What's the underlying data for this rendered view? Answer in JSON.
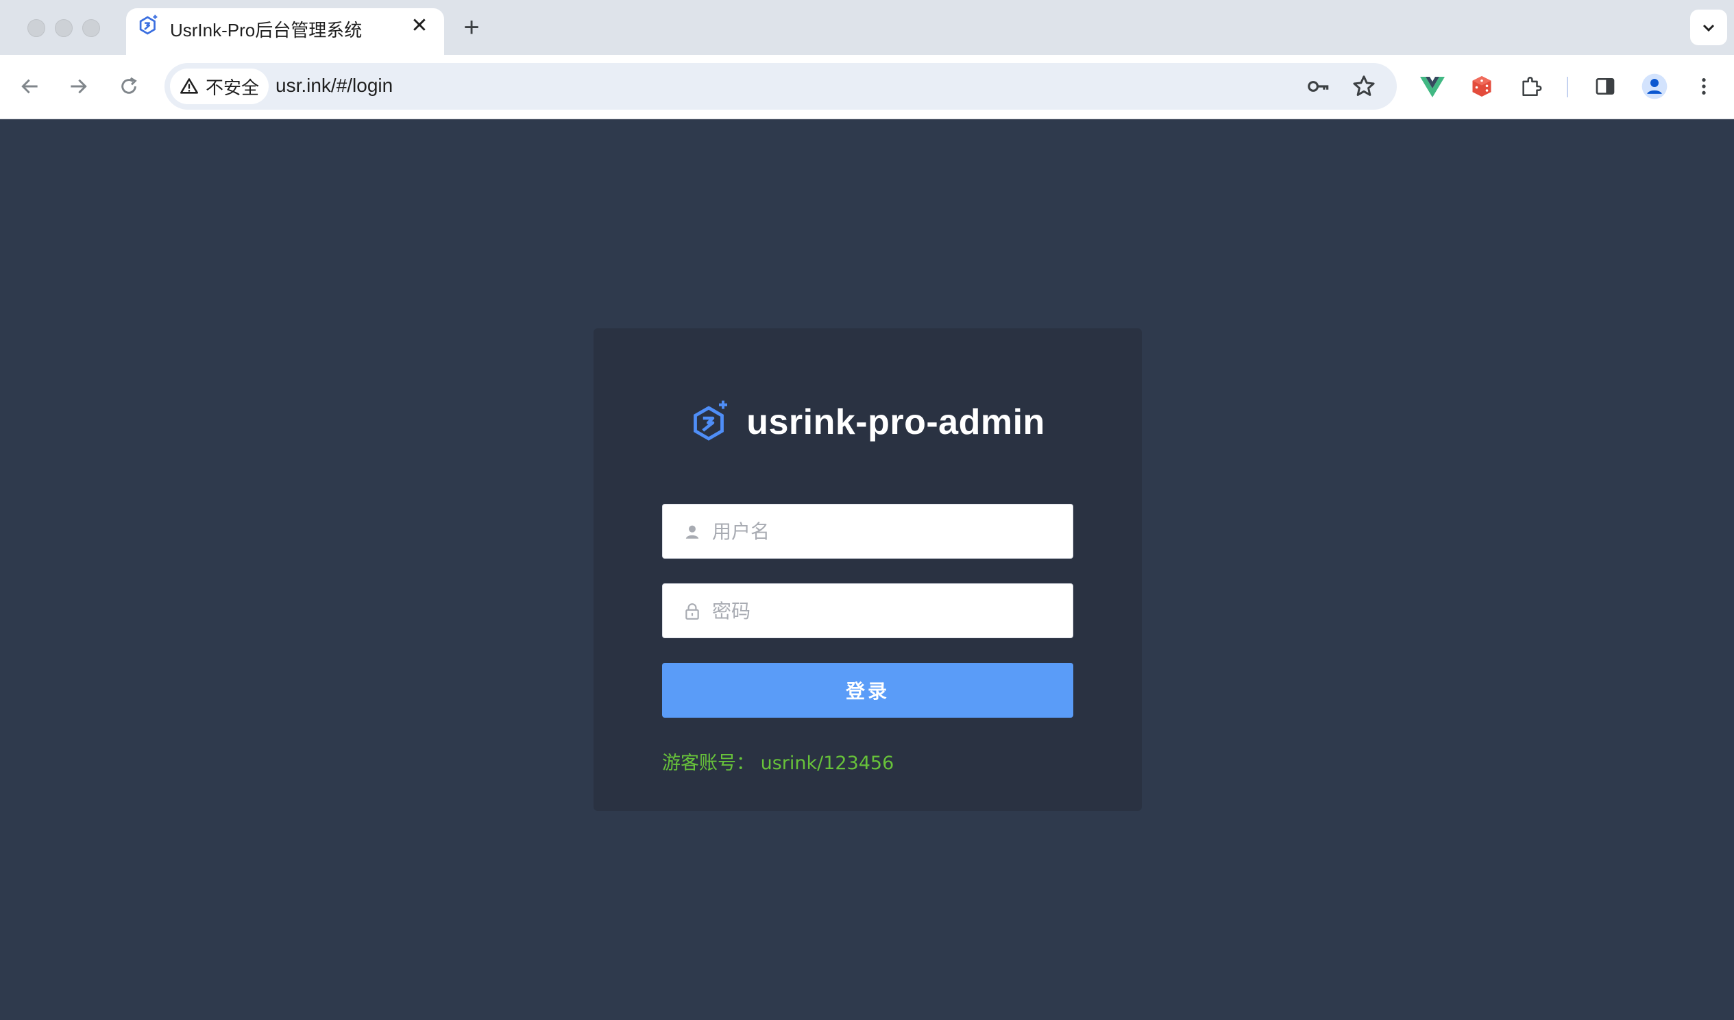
{
  "browser": {
    "tab": {
      "title": "UsrInk-Pro后台管理系统",
      "close_icon": "close-icon",
      "favicon": "usrink-logo-icon"
    },
    "new_tab_symbol": "+",
    "address_bar": {
      "security_label": "不安全",
      "url": "usr.ink/#/login"
    },
    "toolbar_icons": [
      "back-icon",
      "forward-icon",
      "reload-icon",
      "password-key-icon",
      "bookmark-star-icon",
      "vue-devtools-icon",
      "dice-extension-icon",
      "extensions-puzzle-icon",
      "side-panel-icon",
      "profile-icon",
      "menu-more-icon"
    ]
  },
  "login": {
    "brand_title": "usrink-pro-admin",
    "username_placeholder": "用户名",
    "password_placeholder": "密码",
    "submit_label": "登录",
    "guest_account": "游客账号：  usrink/123456"
  },
  "colors": {
    "page_background": "#2f3a4d",
    "card_background": "#2a3242",
    "primary_button": "#5a9cf8",
    "guest_text": "#67c23a",
    "logo_blue": "#4f8ef7"
  }
}
